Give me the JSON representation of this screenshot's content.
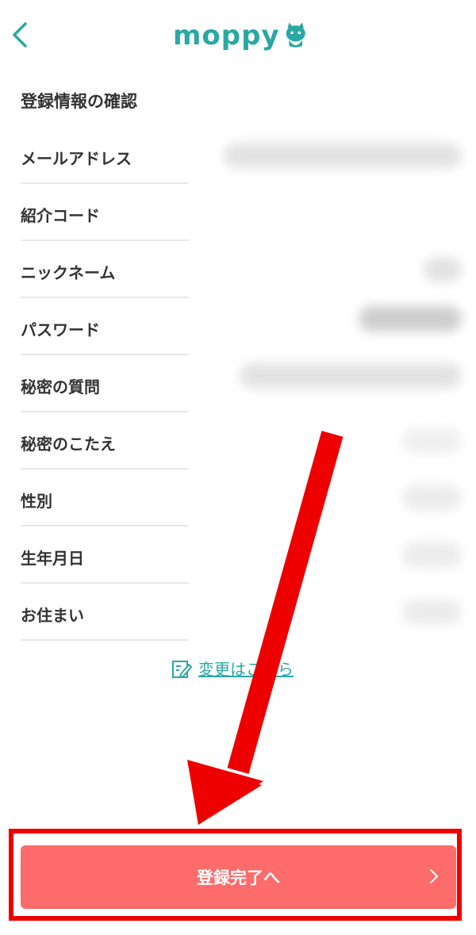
{
  "header": {
    "logo_text": "moppy"
  },
  "section_title": "登録情報の確認",
  "rows": [
    {
      "label": "メールアドレス"
    },
    {
      "label": "紹介コード"
    },
    {
      "label": "ニックネーム"
    },
    {
      "label": "パスワード"
    },
    {
      "label": "秘密の質問"
    },
    {
      "label": "秘密のこたえ"
    },
    {
      "label": "性別"
    },
    {
      "label": "生年月日"
    },
    {
      "label": "お住まい"
    }
  ],
  "change_link": {
    "label": "変更はこちら"
  },
  "complete_button": {
    "label": "登録完了へ"
  },
  "colors": {
    "brand": "#2aa8a4",
    "button": "#fe6b6b",
    "annotation_red": "#ee0000"
  }
}
